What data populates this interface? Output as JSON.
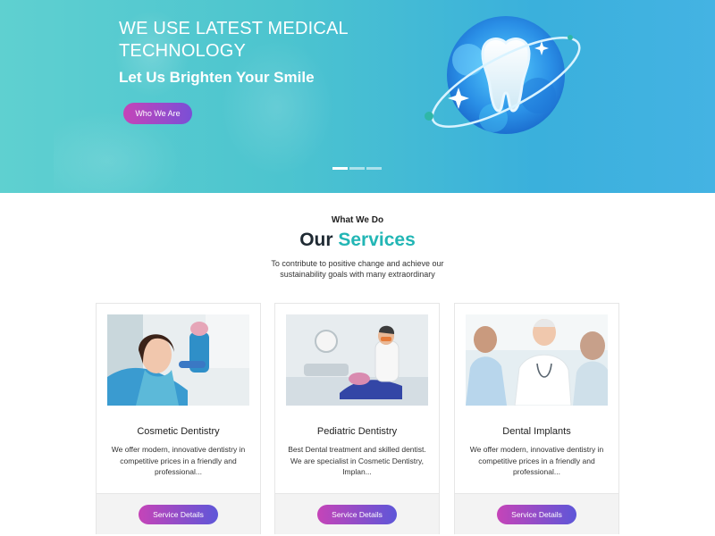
{
  "hero": {
    "title": "WE USE LATEST MEDICAL TECHNOLOGY",
    "subtitle": "Let Us Brighten Your Smile",
    "button_label": "Who We Are",
    "slides_total": 3,
    "active_slide": 1
  },
  "services": {
    "eyebrow": "What We Do",
    "title_prefix": "Our",
    "title_accent": "Services",
    "description": "To contribute to positive change and achieve our sustainability goals with many extraordinary",
    "accent_color": "#22b6b5",
    "cards": [
      {
        "title": "Cosmetic Dentistry",
        "text": "We offer modern, innovative dentistry in competitive prices in a friendly and professional...",
        "button_label": "Service Details"
      },
      {
        "title": "Pediatric Dentistry",
        "text": "Best Dental treatment and skilled dentist. We are specialist in Cosmetic Dentistry, Implan...",
        "button_label": "Service Details"
      },
      {
        "title": "Dental Implants",
        "text": "We offer modern, innovative dentistry in competitive prices in a friendly and professional...",
        "button_label": "Service Details"
      }
    ]
  },
  "colors": {
    "hero_gradient_start": "#5fd0d0",
    "hero_gradient_end": "#44b3e3",
    "button_gradient_start": "#c544b8",
    "button_gradient_end": "#5e56d8"
  }
}
